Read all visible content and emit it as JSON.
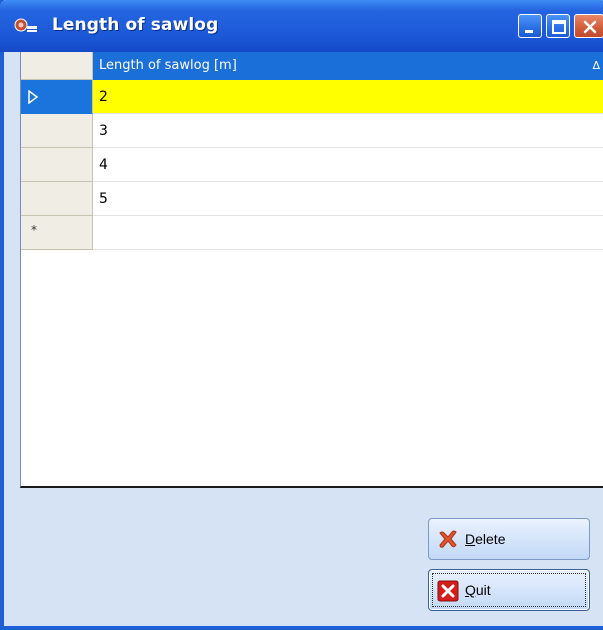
{
  "window": {
    "title": "Length of sawlog",
    "icon": "sawlog-app-icon",
    "controls": [
      "minimize-icon",
      "maximize-icon",
      "close-icon"
    ]
  },
  "grid": {
    "column_header": "Length of sawlog [m]",
    "sort_indicator": "Δ",
    "rows": [
      {
        "value": "2"
      },
      {
        "value": "3"
      },
      {
        "value": "4"
      },
      {
        "value": "5"
      }
    ],
    "new_row_marker": "*"
  },
  "buttons": {
    "delete": {
      "mnemonic": "D",
      "rest": "elete",
      "icon": "delete-x-icon"
    },
    "quit": {
      "mnemonic": "Q",
      "rest": "uit",
      "icon": "quit-x-icon"
    }
  },
  "colors": {
    "selection": "#ffff00",
    "header": "#1a6fd9",
    "titlebar": "#1b58d8"
  }
}
